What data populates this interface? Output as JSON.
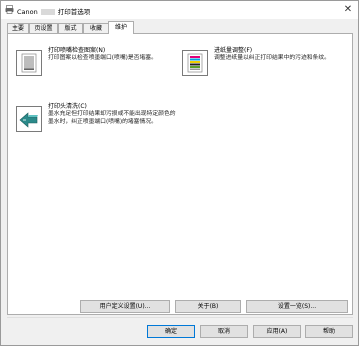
{
  "window": {
    "title_prefix": "Canon",
    "title_suffix": "打印首选项",
    "close_glyph": "✕"
  },
  "tabs": [
    {
      "label": "主要"
    },
    {
      "label": "页设置"
    },
    {
      "label": "版式"
    },
    {
      "label": "收藏"
    },
    {
      "label": "维护"
    }
  ],
  "active_tab": "维护",
  "tools": {
    "nozzle_check": {
      "title": "打印喷嘴检查图案(N)",
      "desc": "打印图案以检查喷墨端口(喷嘴)是否堵塞。"
    },
    "paper_alignment": {
      "title": "进纸量调整(F)",
      "desc": "调整进纸量以纠正打印结果中的污迹和条纹。"
    },
    "print_head_cleaning": {
      "title": "打印头清洗(C)",
      "desc_line1": "墨水充足但打印结果却污损或不能出现特定颜色的",
      "desc_line2": "墨水时，纠正喷墨端口(喷嘴)的堵塞情况。"
    }
  },
  "panel_buttons": {
    "custom_settings": "用户定义设置(U)...",
    "about": "关于(B)",
    "settings_at_once": "设置一览(S)..."
  },
  "dialog_buttons": {
    "ok": "确定",
    "cancel": "取消",
    "apply": "应用(A)",
    "help": "帮助"
  }
}
